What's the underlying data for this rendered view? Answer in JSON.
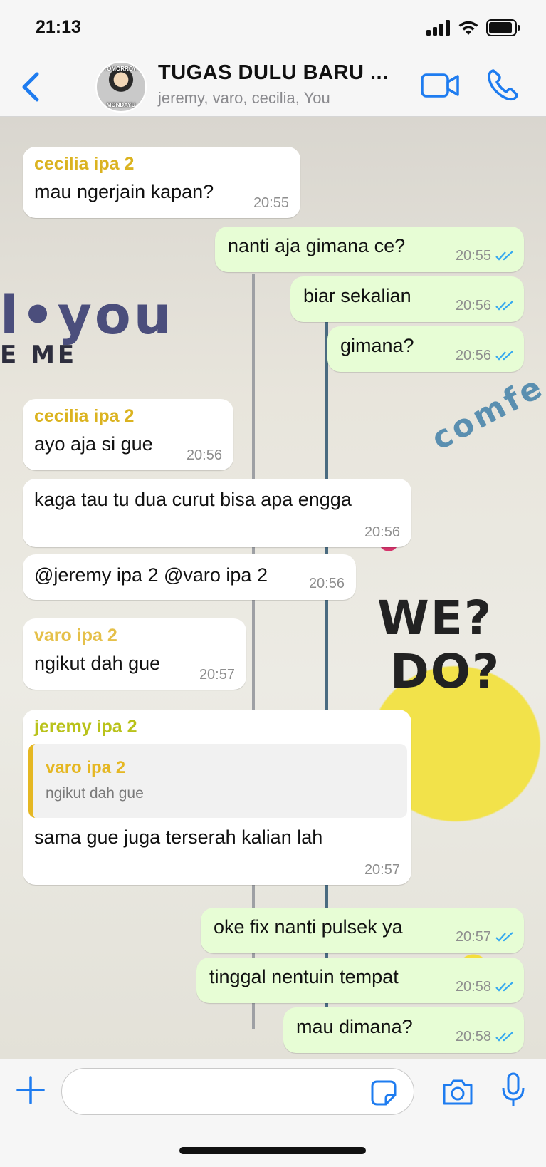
{
  "status_bar": {
    "time": "21:13"
  },
  "header": {
    "avatar_text_top": "TOMORROW",
    "avatar_text_bottom": "MONDAYU",
    "title": "TUGAS DULU BARU ...",
    "members": "jeremy, varo, cecilia, You"
  },
  "wallpaper": {
    "text1": "l•you",
    "text2": "E ME",
    "text3": "comfe",
    "text4": "WE?",
    "text5": "DO?"
  },
  "colors": {
    "cecilia": "#dbb320",
    "varo": "#e5c04a",
    "jeremy": "#b9c21a",
    "accent": "#1e7cf0",
    "outgoing_bubble": "#e7fdd5"
  },
  "messages": [
    {
      "direction": "in",
      "sender": "cecilia ipa 2",
      "text": "mau ngerjain kapan?",
      "time": "20:55"
    },
    {
      "direction": "out",
      "text": "nanti aja gimana ce?",
      "time": "20:55",
      "status": "read"
    },
    {
      "direction": "out",
      "text": "biar sekalian",
      "time": "20:56",
      "status": "read"
    },
    {
      "direction": "out",
      "text": "gimana?",
      "time": "20:56",
      "status": "read"
    },
    {
      "direction": "in",
      "sender": "cecilia ipa 2",
      "text": "ayo aja si gue",
      "time": "20:56"
    },
    {
      "direction": "in",
      "text": "kaga tau tu dua curut bisa apa engga",
      "time": "20:56"
    },
    {
      "direction": "in",
      "text": "@jeremy ipa 2 @varo ipa 2",
      "time": "20:56"
    },
    {
      "direction": "in",
      "sender": "varo ipa 2",
      "text": "ngikut dah gue",
      "time": "20:57"
    },
    {
      "direction": "in",
      "sender": "jeremy ipa 2",
      "quote_sender": "varo ipa 2",
      "quote_text": "ngikut dah gue",
      "text": "sama gue juga terserah kalian lah",
      "time": "20:57"
    },
    {
      "direction": "out",
      "text": "oke fix nanti pulsek ya",
      "time": "20:57",
      "status": "read"
    },
    {
      "direction": "out",
      "text": "tinggal nentuin tempat",
      "time": "20:58",
      "status": "read"
    },
    {
      "direction": "out",
      "text": "mau dimana?",
      "time": "20:58",
      "status": "read"
    }
  ],
  "input": {
    "placeholder": ""
  },
  "icons": [
    "back-chevron-icon",
    "video-call-icon",
    "phone-icon",
    "plus-icon",
    "sticker-icon",
    "camera-icon",
    "microphone-icon",
    "double-check-icon",
    "signal-icon",
    "wifi-icon",
    "battery-icon"
  ]
}
